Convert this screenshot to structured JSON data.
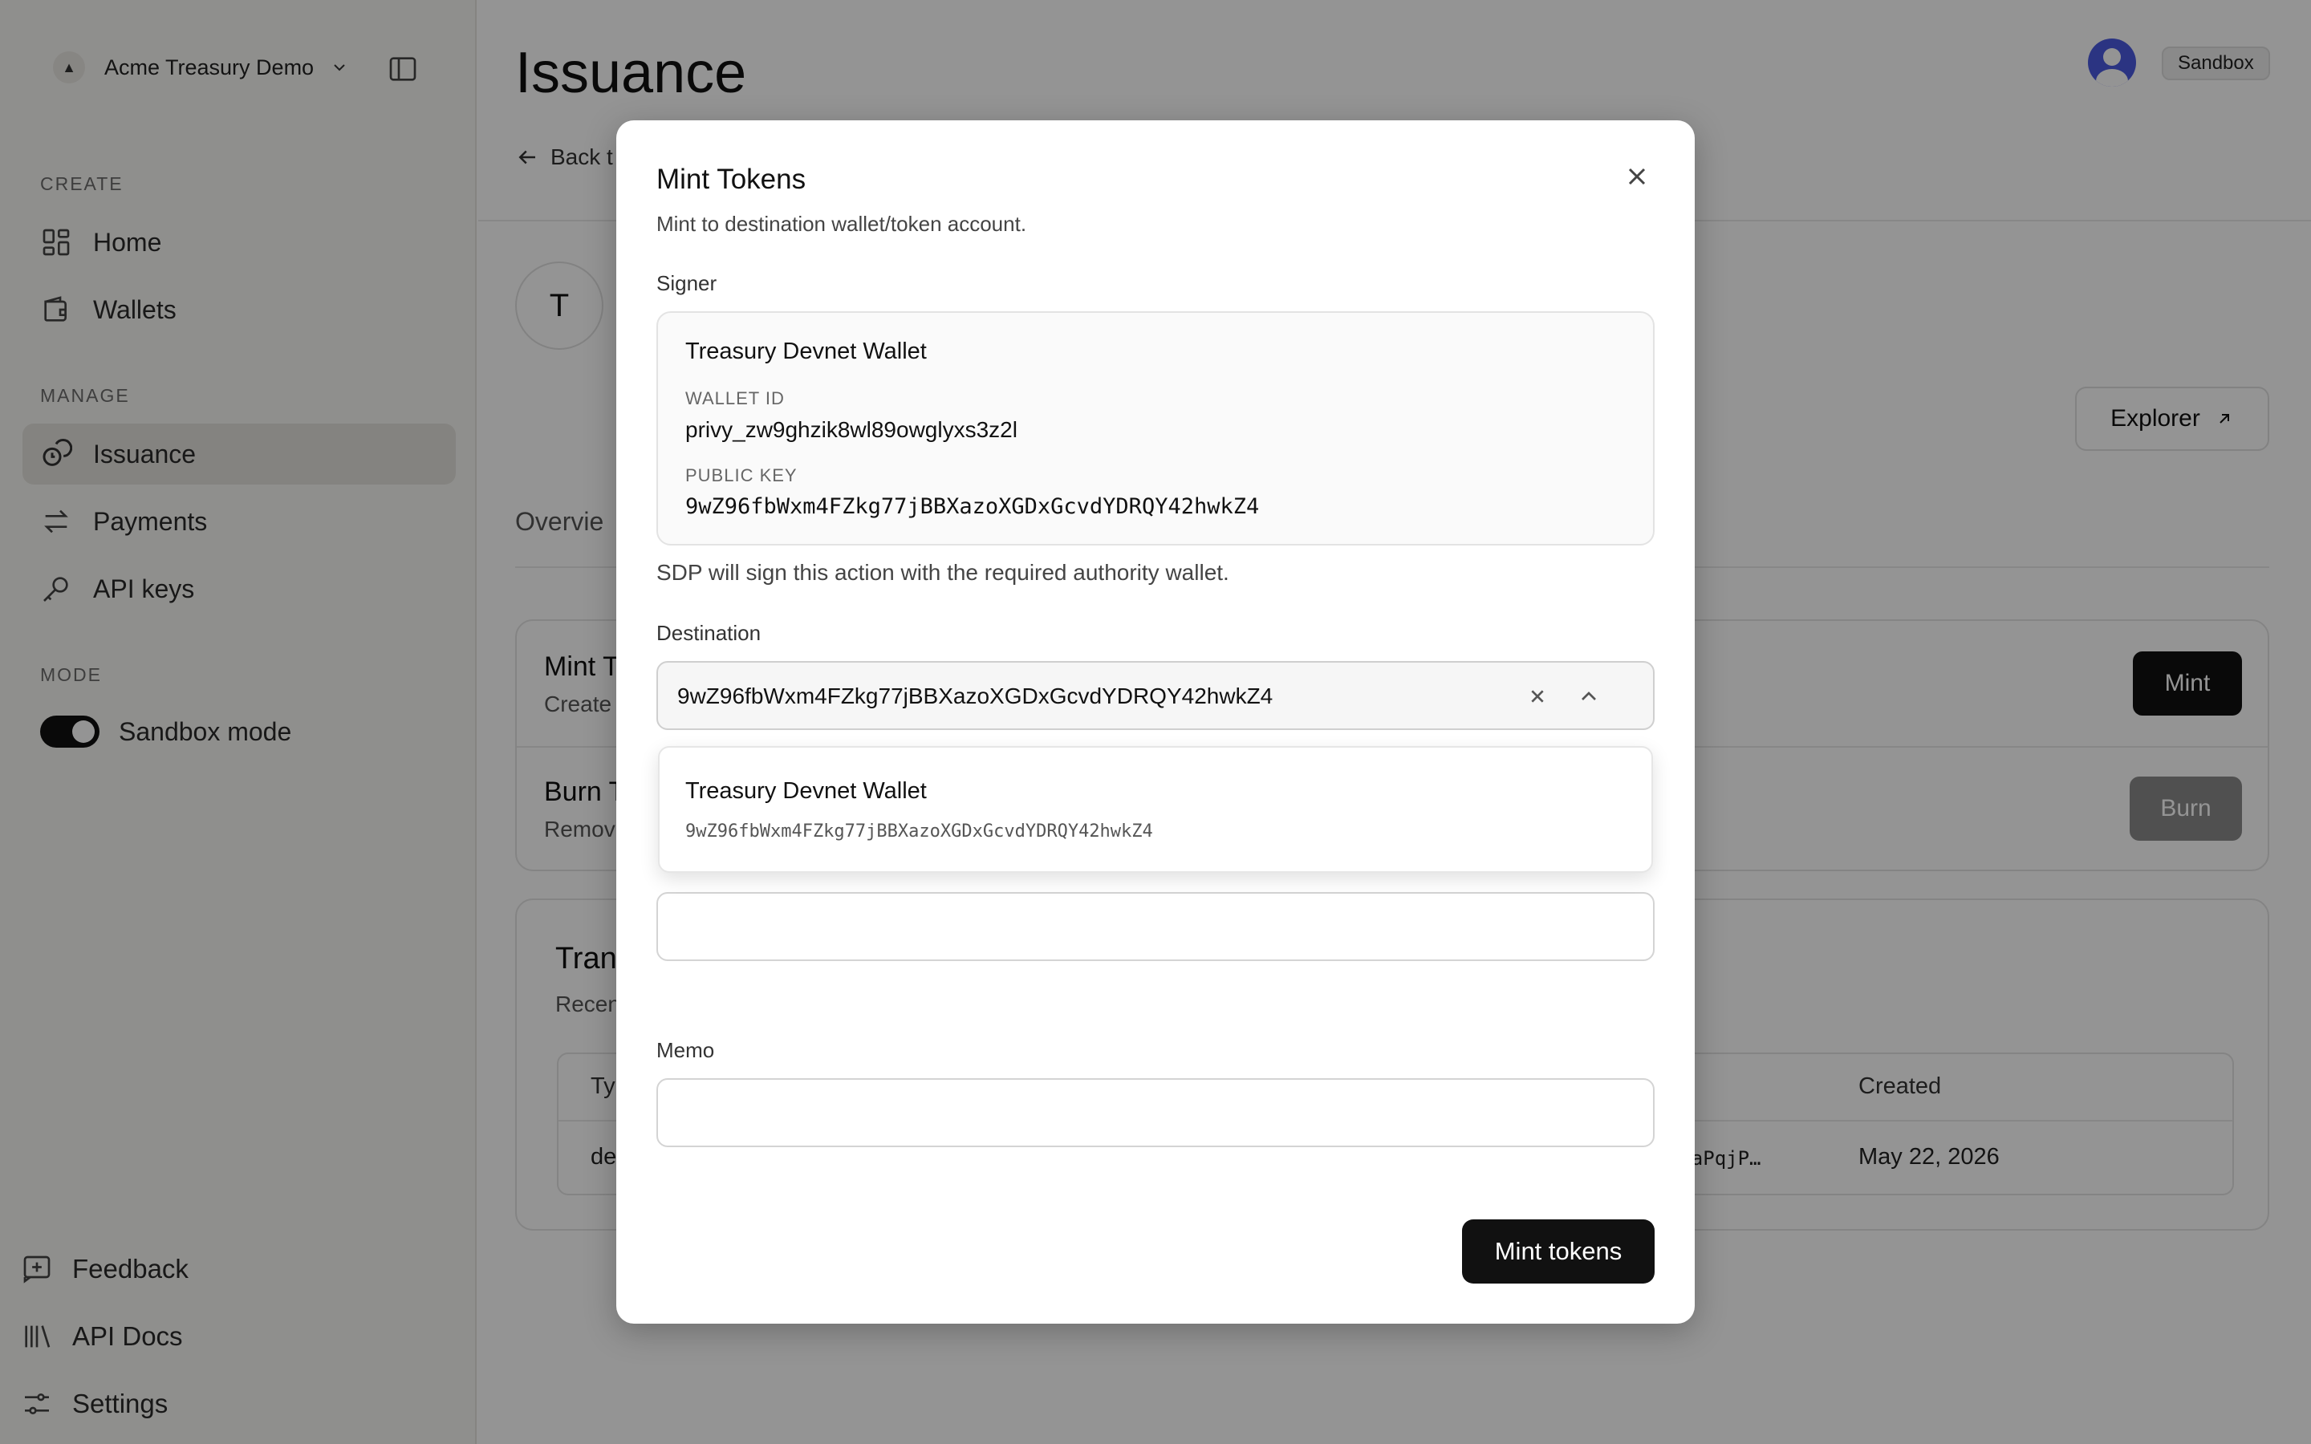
{
  "sidebar": {
    "org_name": "Acme Treasury Demo",
    "sections": {
      "create": "CREATE",
      "manage": "MANAGE",
      "mode": "MODE"
    },
    "items": {
      "home": "Home",
      "wallets": "Wallets",
      "issuance": "Issuance",
      "payments": "Payments",
      "api_keys": "API keys"
    },
    "sandbox_mode_label": "Sandbox mode",
    "footer": {
      "feedback": "Feedback",
      "api_docs": "API Docs",
      "settings": "Settings"
    }
  },
  "header": {
    "title": "Issuance",
    "environment_badge": "Sandbox",
    "back_link": "Back t"
  },
  "token": {
    "avatar_letter": "T",
    "explorer_label": "Explorer",
    "tab_overview": "Overvie"
  },
  "actions_card": {
    "mint_title": "Mint T",
    "mint_sub": "Create",
    "mint_button": "Mint",
    "burn_title": "Burn T",
    "burn_sub": "Remov",
    "burn_button": "Burn"
  },
  "transactions_card": {
    "title": "Tran",
    "subtitle": "Recen",
    "columns": {
      "type": "Typ",
      "created": "Created"
    },
    "row": {
      "type": "de",
      "signature": "SNJoaPqjP…",
      "created": "May 22, 2026"
    }
  },
  "modal": {
    "title": "Mint Tokens",
    "description": "Mint to destination wallet/token account.",
    "signer_label": "Signer",
    "signer": {
      "name": "Treasury Devnet Wallet",
      "wallet_id_label": "WALLET ID",
      "wallet_id": "privy_zw9ghzik8wl89owglyxs3z2l",
      "public_key_label": "PUBLIC KEY",
      "public_key": "9wZ96fbWxm4FZkg77jBBXazoXGDxGcvdYDRQY42hwkZ4"
    },
    "signer_note": "SDP will sign this action with the required authority wallet.",
    "destination_label": "Destination",
    "destination_value": "9wZ96fbWxm4FZkg77jBBXazoXGDxGcvdYDRQY42hwkZ4",
    "dropdown_option": {
      "name": "Treasury Devnet Wallet",
      "address": "9wZ96fbWxm4FZkg77jBBXazoXGDxGcvdYDRQY42hwkZ4"
    },
    "amount_value": "",
    "memo_label": "Memo",
    "memo_value": "",
    "submit_label": "Mint tokens"
  },
  "icons": {
    "org": "org-logo-icon",
    "chevron": "chevron-down-icon",
    "sidebar_toggle": "sidebar-toggle-icon",
    "close": "close-icon"
  }
}
